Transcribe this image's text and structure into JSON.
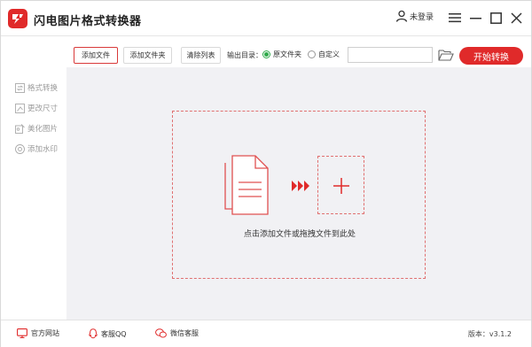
{
  "app": {
    "title": "闪电图片格式转换器",
    "user_label": "未登录"
  },
  "toolbar": {
    "add_file": "添加文件",
    "add_folder": "添加文件夹",
    "clear_list": "清除列表",
    "output_label": "输出目录：",
    "radio_original": "原文件夹",
    "radio_custom": "自定义",
    "selected_output": "原文件夹",
    "path_value": "",
    "start": "开始转换"
  },
  "sidebar": {
    "items": [
      {
        "label": "格式转换",
        "icon": "convert-icon"
      },
      {
        "label": "更改尺寸",
        "icon": "resize-icon"
      },
      {
        "label": "美化图片",
        "icon": "beautify-icon"
      },
      {
        "label": "添加水印",
        "icon": "watermark-icon"
      }
    ]
  },
  "main": {
    "drop_hint": "点击添加文件或拖拽文件到此处"
  },
  "footer": {
    "website": "官方网站",
    "qq": "客服QQ",
    "wechat": "微信客服",
    "version": "版本：v3.1.2"
  },
  "colors": {
    "accent": "#e02a2a",
    "dashed": "#e07070",
    "radio_on": "#2eaa4a",
    "main_bg": "#f1f1f4"
  }
}
